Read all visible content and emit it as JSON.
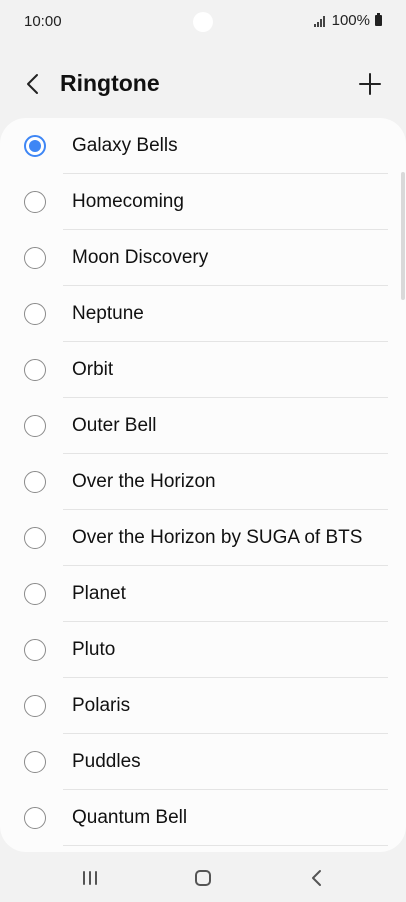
{
  "status_bar": {
    "time": "10:00",
    "battery_text": "100%",
    "icons": [
      "signal-icon",
      "battery-icon"
    ]
  },
  "header": {
    "title": "Ringtone",
    "back_icon": "chevron-left-icon",
    "add_icon": "plus-icon"
  },
  "ringtones": [
    {
      "label": "Galaxy Bells",
      "selected": true
    },
    {
      "label": "Homecoming",
      "selected": false
    },
    {
      "label": "Moon Discovery",
      "selected": false
    },
    {
      "label": "Neptune",
      "selected": false
    },
    {
      "label": "Orbit",
      "selected": false
    },
    {
      "label": "Outer Bell",
      "selected": false
    },
    {
      "label": "Over the Horizon",
      "selected": false
    },
    {
      "label": "Over the Horizon by SUGA of BTS",
      "selected": false
    },
    {
      "label": "Planet",
      "selected": false
    },
    {
      "label": "Pluto",
      "selected": false
    },
    {
      "label": "Polaris",
      "selected": false
    },
    {
      "label": "Puddles",
      "selected": false
    },
    {
      "label": "Quantum Bell",
      "selected": false
    }
  ],
  "nav_bar": {
    "recent_icon": "recent-apps-icon",
    "home_icon": "home-icon",
    "back_icon": "back-icon"
  },
  "colors": {
    "accent": "#3e86f5",
    "background": "#f2f2f2",
    "card": "#fcfcfc"
  }
}
